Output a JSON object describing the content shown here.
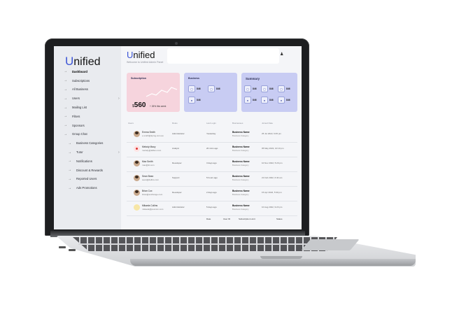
{
  "app": {
    "logo_initial": "U",
    "logo_rest": "nified",
    "title_initial": "U",
    "title_rest": "nified",
    "subtitle": "Welcome to Unified Admin Panel"
  },
  "sidebar": {
    "items": [
      {
        "label": "Dashboard",
        "active": true,
        "indent": 0,
        "has_chevron": false
      },
      {
        "label": "Subscriptions",
        "active": false,
        "indent": 0,
        "has_chevron": false
      },
      {
        "label": "All Business",
        "active": false,
        "indent": 0,
        "has_chevron": false
      },
      {
        "label": "Users",
        "active": false,
        "indent": 0,
        "has_chevron": true
      },
      {
        "label": "Mailing List",
        "active": false,
        "indent": 0,
        "has_chevron": false
      },
      {
        "label": "Filters",
        "active": false,
        "indent": 0,
        "has_chevron": false
      },
      {
        "label": "Sponsors",
        "active": false,
        "indent": 0,
        "has_chevron": false
      },
      {
        "label": "Group Chat",
        "active": false,
        "indent": 0,
        "has_chevron": false
      },
      {
        "label": "Business Categories",
        "active": false,
        "indent": 1,
        "has_chevron": false
      },
      {
        "label": "Tutor",
        "active": false,
        "indent": 1,
        "has_chevron": true
      },
      {
        "label": "Notifications",
        "active": false,
        "indent": 1,
        "has_chevron": false
      },
      {
        "label": "Discount & Rewards",
        "active": false,
        "indent": 1,
        "has_chevron": false
      },
      {
        "label": "Reported Users",
        "active": false,
        "indent": 1,
        "has_chevron": false
      },
      {
        "label": "Ads Promotions",
        "active": false,
        "indent": 1,
        "has_chevron": false
      }
    ]
  },
  "cards": {
    "subscription": {
      "title": "Subscription",
      "currency": "$",
      "value": "560",
      "note": "+ 26% this week"
    },
    "business": {
      "title": "Business",
      "stats": [
        "846",
        "846",
        "846"
      ]
    },
    "summary": {
      "title": "Summary",
      "stats": [
        "846",
        "846",
        "846",
        "846",
        "846",
        "846"
      ]
    }
  },
  "table": {
    "headers": [
      "Users",
      "Roles",
      "Last Login",
      "Businesses",
      "Joined Date"
    ],
    "rows": [
      {
        "name": "Emma Smith",
        "email": "e.smith@kpmg.com.au",
        "role": "Administrator",
        "login": "Yesterday",
        "business": "Business Name",
        "category": "Business Category",
        "date": "25 Jul 2022, 6:05 pm",
        "avatar": "photo"
      },
      {
        "name": "Melody Macy",
        "email": "melody@altbox.com",
        "role": "Analyst",
        "login": "20 mins ago",
        "business": "Business Name",
        "category": "Business Category",
        "date": "05 May 2022, 10:10 pm",
        "avatar": "red"
      },
      {
        "name": "Max Smith",
        "email": "max@kt.com",
        "role": "Developer",
        "login": "3 days ago",
        "business": "Business Name",
        "category": "Business Category",
        "date": "10 Nov 2022, 5:20 pm",
        "avatar": "photo"
      },
      {
        "name": "Sean Bean",
        "email": "sean@dellito.com",
        "role": "Support",
        "login": "5 hours ago",
        "business": "Business Name",
        "category": "Business Category",
        "date": "21 Feb 2022, 6:43 am",
        "avatar": "photo"
      },
      {
        "name": "Brian Cox",
        "email": "brian@exchange.com",
        "role": "Developer",
        "login": "2 days ago",
        "business": "Business Name",
        "category": "Business Category",
        "date": "15 Apr 2022, 5:30 pm",
        "avatar": "photo"
      },
      {
        "name": "Mikaela Collins",
        "email": "mikaela@pexcom.com",
        "role": "Administrator",
        "login": "5 days ago",
        "business": "Business Name",
        "category": "Business Category",
        "date": "10 Aug 2022, 9:23 pm",
        "avatar": "yellow"
      }
    ]
  },
  "bottom_tabs": [
    "Date",
    "User ID",
    "Subscription Limit",
    "Status"
  ],
  "colors": {
    "accent": "#3d56d6",
    "pink_card": "#f6d4dd",
    "lavender_card": "#c8ccf3",
    "sidebar": "#e9ebef"
  }
}
